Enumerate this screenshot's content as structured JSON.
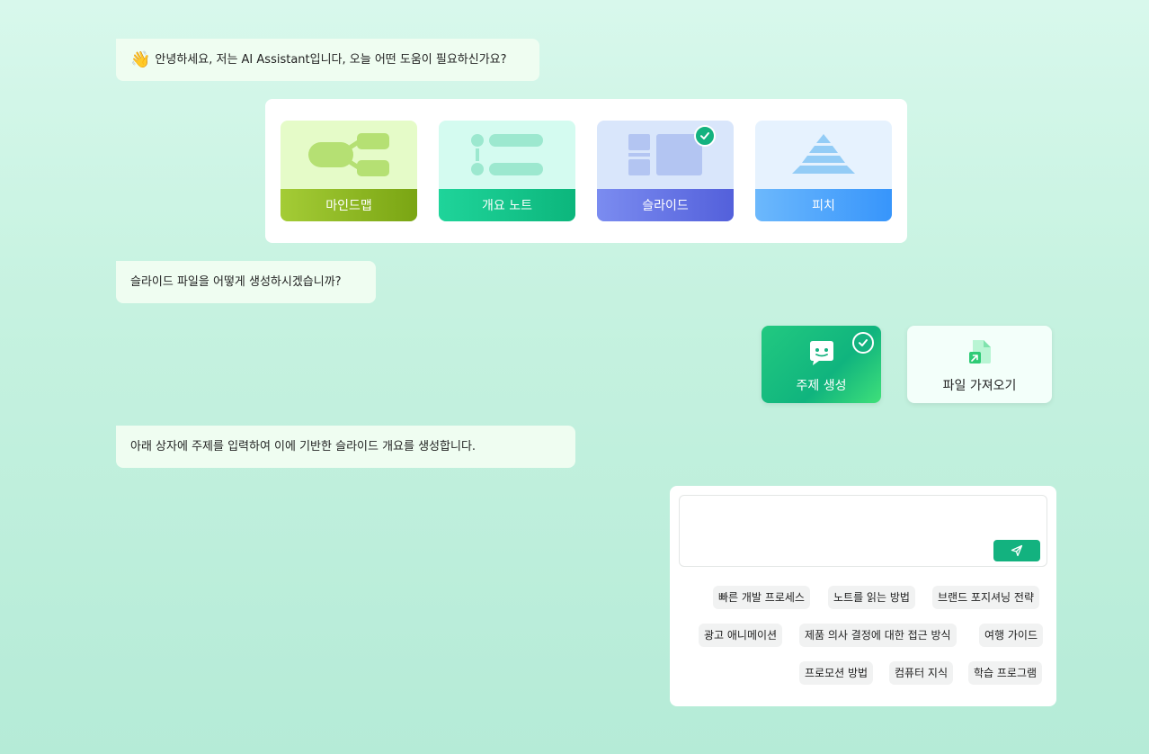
{
  "messages": {
    "greeting": {
      "icon": "waving-hand-icon",
      "emoji": "👋",
      "text": "안녕하세요, 저는 AI Assistant입니다, 오늘 어떤 도움이 필요하신가요?"
    },
    "ask_method": "슬라이드 파일을 어떻게 생성하시겠습니까?",
    "instruction": "아래 상자에 주제를 입력하여 이에 기반한 슬라이드 개요를 생성합니다."
  },
  "doc_types": [
    {
      "label": "마인드맵",
      "icon": "mind-map-icon",
      "selected": false
    },
    {
      "label": "개요 노트",
      "icon": "outline-notes-icon",
      "selected": false
    },
    {
      "label": "슬라이드",
      "icon": "slides-icon",
      "selected": true
    },
    {
      "label": "피치",
      "icon": "pitch-pyramid-icon",
      "selected": false
    }
  ],
  "modes": [
    {
      "label": "주제 생성",
      "icon": "chat-bot-icon",
      "selected": true
    },
    {
      "label": "파일 가져오기",
      "icon": "file-import-icon",
      "selected": false
    }
  ],
  "topic_input": {
    "value": "",
    "placeholder": "",
    "send_icon": "send-icon"
  },
  "suggestions": [
    "빠른 개발 프로세스",
    "노트를 읽는 방법",
    "브랜드 포지셔닝 전략",
    "광고 애니메이션",
    "제품 의사 결정에 대한 접근 방식",
    "여행 가이드",
    "프로모션 방법",
    "컴퓨터 지식",
    "학습 프로그램"
  ],
  "colors": {
    "accent": "#13b27f",
    "bubble": "#effdf1"
  }
}
